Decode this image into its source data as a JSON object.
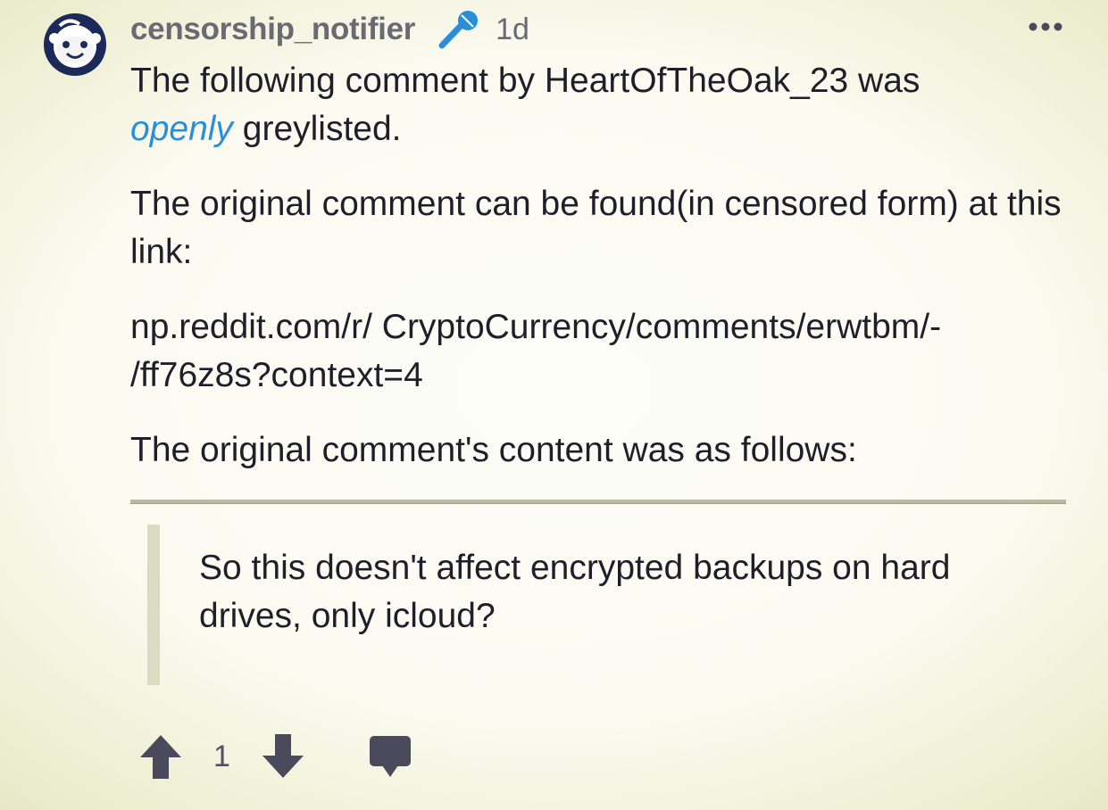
{
  "post": {
    "username": "censorship_notifier",
    "age": "1d",
    "avatar_icon": "snoo-avatar-icon",
    "badge_icon": "microphone-icon",
    "menu_icon": "more-options-icon"
  },
  "body": {
    "line1_prefix": "The following comment by HeartOfTheOak_23 was",
    "line1_emphasis": "openly",
    "line1_suffix": " greylisted.",
    "paragraph2": "The original comment can be found(in censored form) at this link:",
    "link_line1": "np.reddit.com/r/ CryptoCurrency/comments/erwtbm/-",
    "link_line2": "/ff76z8s?context=4",
    "paragraph4": "The original comment's content was as follows:"
  },
  "quote": {
    "text": "So this doesn't affect encrypted backups on hard drives, only icloud?"
  },
  "actions": {
    "score": "1",
    "upvote_icon": "upvote-arrow-icon",
    "downvote_icon": "downvote-arrow-icon",
    "comment_icon": "comment-bubble-icon"
  },
  "colors": {
    "accent_blue": "#2a8ed8",
    "username_grey": "#6a6a72",
    "icon_dark": "#4a4a5c",
    "background": "#fbfbf2"
  }
}
